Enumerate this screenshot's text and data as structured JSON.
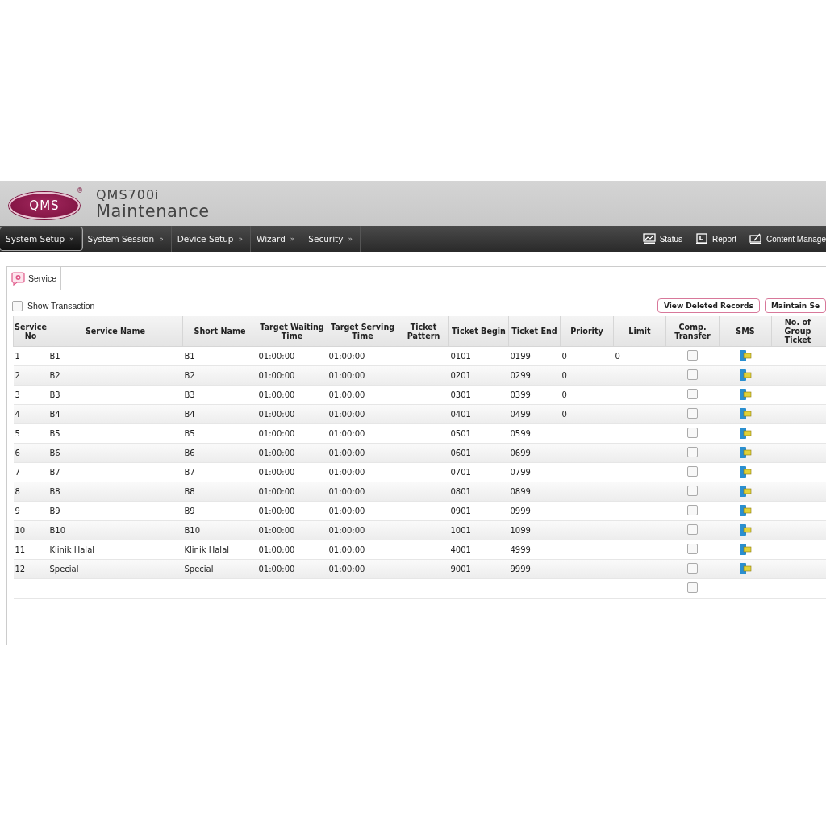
{
  "header": {
    "logo": "QMS",
    "logo_mark": "®",
    "product": "QMS700i",
    "title": "Maintenance"
  },
  "nav": [
    {
      "label": "System Setup",
      "arrow": "»",
      "selected": true
    },
    {
      "label": "System Session",
      "arrow": "»",
      "selected": false
    },
    {
      "label": "Device Setup",
      "arrow": "»",
      "selected": false
    },
    {
      "label": "Wizard",
      "arrow": "»",
      "selected": false
    },
    {
      "label": "Security",
      "arrow": "»",
      "selected": false
    }
  ],
  "nav_right": [
    {
      "label": "Status",
      "kind": "chart"
    },
    {
      "label": "Report",
      "kind": "report"
    },
    {
      "label": "Content Manage",
      "kind": "edit"
    }
  ],
  "tabs": [
    {
      "label": "Service",
      "selected": true
    }
  ],
  "show_transaction": {
    "label": "Show Transaction",
    "checked": false
  },
  "buttons": [
    "View Deleted Records",
    "Maintain Se"
  ],
  "table": {
    "columns": [
      "Service No",
      "Service Name",
      "Short Name",
      "Target Waiting Time",
      "Target Serving Time",
      "Ticket Pattern",
      "Ticket Begin",
      "Ticket End",
      "Priority",
      "Limit",
      "Comp. Transfer",
      "SMS",
      "No. of Group Ticket"
    ],
    "rows": [
      {
        "no": "1",
        "name": "B1",
        "short": "B1",
        "wait": "01:00:00",
        "serve": "01:00:00",
        "begin": "0101",
        "end": "0199",
        "priority": "0",
        "limit": "0",
        "comp_transfer": false
      },
      {
        "no": "2",
        "name": "B2",
        "short": "B2",
        "wait": "01:00:00",
        "serve": "01:00:00",
        "begin": "0201",
        "end": "0299",
        "priority": "0",
        "comp_transfer": false
      },
      {
        "no": "3",
        "name": "B3",
        "short": "B3",
        "wait": "01:00:00",
        "serve": "01:00:00",
        "begin": "0301",
        "end": "0399",
        "priority": "0",
        "comp_transfer": false
      },
      {
        "no": "4",
        "name": "B4",
        "short": "B4",
        "wait": "01:00:00",
        "serve": "01:00:00",
        "begin": "0401",
        "end": "0499",
        "priority": "0",
        "comp_transfer": false
      },
      {
        "no": "5",
        "name": "B5",
        "short": "B5",
        "wait": "01:00:00",
        "serve": "01:00:00",
        "begin": "0501",
        "end": "0599",
        "comp_transfer": false
      },
      {
        "no": "6",
        "name": "B6",
        "short": "B6",
        "wait": "01:00:00",
        "serve": "01:00:00",
        "begin": "0601",
        "end": "0699",
        "comp_transfer": false
      },
      {
        "no": "7",
        "name": "B7",
        "short": "B7",
        "wait": "01:00:00",
        "serve": "01:00:00",
        "begin": "0701",
        "end": "0799",
        "comp_transfer": false
      },
      {
        "no": "8",
        "name": "B8",
        "short": "B8",
        "wait": "01:00:00",
        "serve": "01:00:00",
        "begin": "0801",
        "end": "0899",
        "comp_transfer": false
      },
      {
        "no": "9",
        "name": "B9",
        "short": "B9",
        "wait": "01:00:00",
        "serve": "01:00:00",
        "begin": "0901",
        "end": "0999",
        "comp_transfer": false
      },
      {
        "no": "10",
        "name": "B10",
        "short": "B10",
        "wait": "01:00:00",
        "serve": "01:00:00",
        "begin": "1001",
        "end": "1099",
        "comp_transfer": false
      },
      {
        "no": "11",
        "name": "Klinik Halal",
        "short": "Klinik Halal",
        "wait": "01:00:00",
        "serve": "01:00:00",
        "begin": "4001",
        "end": "4999",
        "comp_transfer": false
      },
      {
        "no": "12",
        "name": "Special",
        "short": "Special",
        "wait": "01:00:00",
        "serve": "01:00:00",
        "begin": "9001",
        "end": "9999",
        "comp_transfer": false
      },
      {
        "comp_transfer": false
      }
    ]
  }
}
